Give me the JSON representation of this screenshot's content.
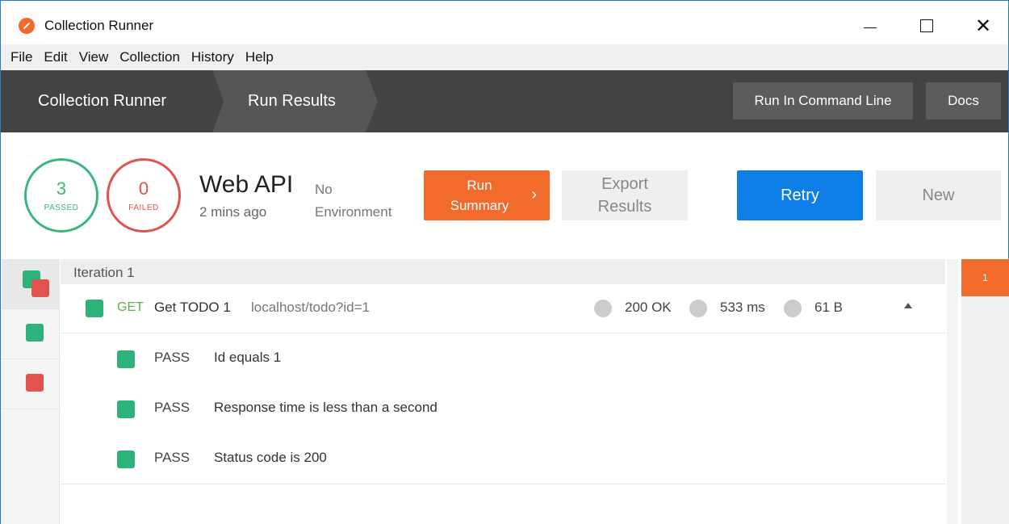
{
  "window": {
    "title": "Collection Runner",
    "controls": {
      "minimize": "—",
      "maximize": "☐",
      "close": "✕"
    }
  },
  "menu": [
    "File",
    "Edit",
    "View",
    "Collection",
    "History",
    "Help"
  ],
  "header": {
    "breadcrumbs": [
      "Collection Runner",
      "Run Results"
    ],
    "run_cmd_label": "Run In Command Line",
    "docs_label": "Docs"
  },
  "summary": {
    "passed_count": "3",
    "passed_label": "PASSED",
    "failed_count": "0",
    "failed_label": "FAILED",
    "collection_name": "Web API",
    "time_ago": "2 mins ago",
    "environment_line1": "No",
    "environment_line2": "Environment",
    "run_summary_line1": "Run",
    "run_summary_line2": "Summary",
    "run_summary_chevron": "›",
    "export_line1": "Export",
    "export_line2": "Results",
    "retry_label": "Retry",
    "new_label": "New"
  },
  "iteration": {
    "title": "Iteration 1",
    "badge": "1"
  },
  "request": {
    "method": "GET",
    "name": "Get TODO 1",
    "url": "localhost/todo?id=1",
    "status": "200 OK",
    "time": "533 ms",
    "size": "61 B"
  },
  "tests": [
    {
      "status": "PASS",
      "name": "Id equals 1"
    },
    {
      "status": "PASS",
      "name": "Response time is less than a second"
    },
    {
      "status": "PASS",
      "name": "Status code is 200"
    }
  ],
  "colors": {
    "accent_orange": "#f26b2c",
    "pass_green": "#2db27a",
    "fail_red": "#e0534e",
    "retry_blue": "#0d7ee6",
    "header_dark": "#434343"
  }
}
